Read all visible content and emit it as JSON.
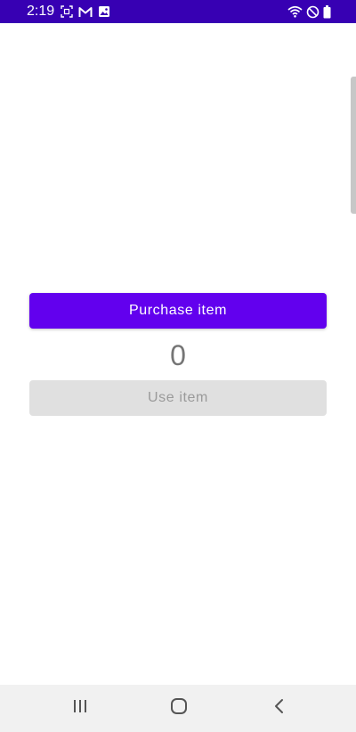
{
  "status_bar": {
    "time": "2:19",
    "left_icons": [
      "screenshot-icon",
      "gmail-icon",
      "gallery-icon"
    ],
    "right_icons": [
      "wifi-icon",
      "do-not-disturb-icon",
      "battery-icon"
    ],
    "color": "#3700b3"
  },
  "main": {
    "purchase_button_label": "Purchase item",
    "count": "0",
    "use_button_label": "Use item",
    "use_button_enabled": false,
    "accent_color": "#6200ee"
  },
  "nav_bar": {
    "buttons": [
      "recents-icon",
      "home-icon",
      "back-icon"
    ]
  }
}
